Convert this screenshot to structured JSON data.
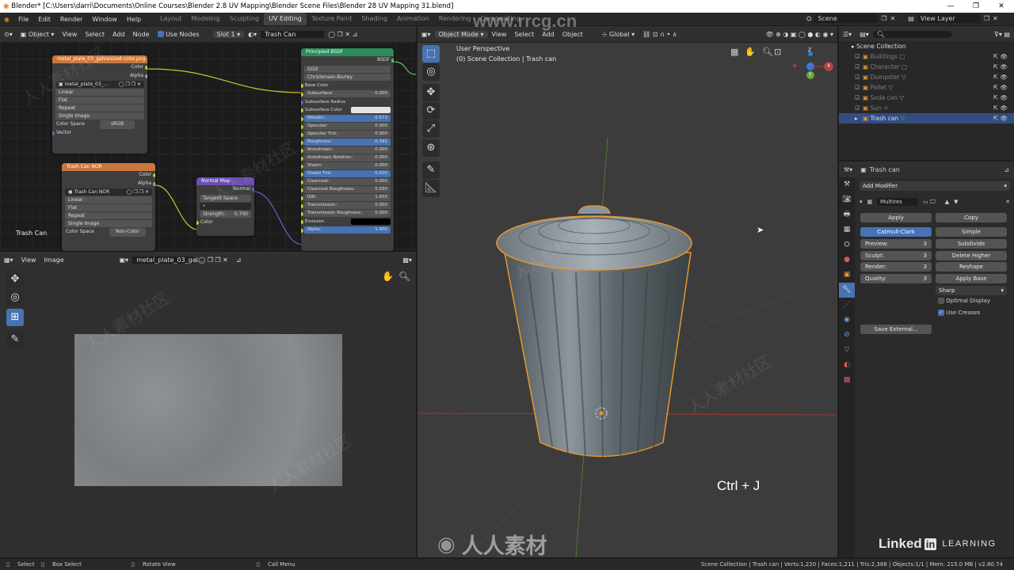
{
  "window": {
    "title": "Blender* [C:\\Users\\darri\\Documents\\Online Courses\\Blender 2.8 UV Mapping\\Blender Scene Files\\Blender 28 UV Mapping 31.blend]"
  },
  "menu": [
    "File",
    "Edit",
    "Render",
    "Window",
    "Help"
  ],
  "workspaces": [
    "Layout",
    "Modeling",
    "Sculpting",
    "UV Editing",
    "Texture Paint",
    "Shading",
    "Animation",
    "Rendering",
    "Compositing"
  ],
  "active_workspace": "UV Editing",
  "scene": {
    "name": "Scene",
    "view_layer": "View Layer"
  },
  "node_editor": {
    "header": {
      "mode": "Object",
      "view": "View",
      "select": "Select",
      "add": "Add",
      "node": "Node",
      "use_nodes": "Use Nodes",
      "slot": "Slot 1",
      "material": "Trash Can"
    },
    "label_material": "Trash Can",
    "node_color": {
      "title": "metal_plate_03_galvanized-color.png",
      "out_color": "Color",
      "out_alpha": "Alpha",
      "image": "metal_plate_03_...",
      "interp": "Linear",
      "proj": "Flat",
      "ext": "Repeat",
      "src": "Single Image",
      "cs_label": "Color Space",
      "cs_val": "sRGB",
      "vector": "Vector"
    },
    "node_nor": {
      "title": "Trash Can NOR",
      "out_color": "Color",
      "out_alpha": "Alpha",
      "image": "Trash Can NOR",
      "interp": "Linear",
      "proj": "Flat",
      "ext": "Repeat",
      "src": "Single Image",
      "cs_label": "Color Space",
      "cs_val": "Non-Color"
    },
    "node_normal": {
      "title": "Normal Map",
      "out": "Normal",
      "space": "Tangent Space",
      "uv": "",
      "strength_label": "Strength:",
      "strength": "0.700",
      "in_color": "Color"
    },
    "node_bsdf": {
      "title": "Principled BSDF",
      "out": "BSDF",
      "dist": "GGX",
      "sss": "Christensen-Burley",
      "rows": [
        {
          "label": "Base Color",
          "value": "",
          "kind": "plain"
        },
        {
          "label": "Subsurface:",
          "value": "0.000",
          "kind": "field"
        },
        {
          "label": "Subsurface Radius",
          "value": "",
          "kind": "plain"
        },
        {
          "label": "Subsurface Color",
          "value": "",
          "kind": "color"
        },
        {
          "label": "Metallic:",
          "value": "0.573",
          "kind": "blue"
        },
        {
          "label": "Specular:",
          "value": "0.000",
          "kind": "field"
        },
        {
          "label": "Specular Tint:",
          "value": "0.000",
          "kind": "field"
        },
        {
          "label": "Roughness",
          "value": "0.341",
          "kind": "blue"
        },
        {
          "label": "Anisotropic:",
          "value": "0.000",
          "kind": "field"
        },
        {
          "label": "Anisotropic Rotation:",
          "value": "0.000",
          "kind": "field"
        },
        {
          "label": "Sheen:",
          "value": "0.000",
          "kind": "field"
        },
        {
          "label": "Sheen Tint:",
          "value": "0.500",
          "kind": "blue"
        },
        {
          "label": "Clearcoat:",
          "value": "0.000",
          "kind": "field"
        },
        {
          "label": "Clearcoat Roughness:",
          "value": "0.030",
          "kind": "field"
        },
        {
          "label": "IOR:",
          "value": "1.450",
          "kind": "field"
        },
        {
          "label": "Transmission:",
          "value": "0.000",
          "kind": "field"
        },
        {
          "label": "Transmission Roughness:",
          "value": "0.000",
          "kind": "field"
        },
        {
          "label": "Emission",
          "value": "",
          "kind": "black"
        },
        {
          "label": "Alpha:",
          "value": "1.000",
          "kind": "blue"
        }
      ]
    }
  },
  "image_editor": {
    "view": "View",
    "image": "Image",
    "image_name": "metal_plate_03_gal..."
  },
  "viewport": {
    "mode": "Object Mode",
    "view": "View",
    "select": "Select",
    "add": "Add",
    "object": "Object",
    "orientation": "Global",
    "perspective": "User Perspective",
    "collection": "(0) Scene Collection | Trash can",
    "shortcut": "Ctrl + J",
    "gizmo": {
      "x": "X",
      "y": "Y",
      "z": "Z"
    }
  },
  "outliner": {
    "root": "Scene Collection",
    "items": [
      "Buildings",
      "Character",
      "Dumpster",
      "Pallet",
      "Soda can",
      "Sun",
      "Trash can"
    ],
    "selected": "Trash can"
  },
  "properties": {
    "object": "Trash can",
    "add_modifier": "Add Modifier",
    "modifier_name": "Multires",
    "apply": "Apply",
    "copy": "Copy",
    "catmull": "Catmull-Clark",
    "simple": "Simple",
    "fields": [
      {
        "label": "Preview:",
        "value": "3"
      },
      {
        "label": "Sculpt:",
        "value": "3"
      },
      {
        "label": "Render:",
        "value": "3"
      },
      {
        "label": "Quality:",
        "value": "3"
      }
    ],
    "subdivide": "Subdivide",
    "delete_higher": "Delete Higher",
    "reshape": "Reshape",
    "apply_base": "Apply Base",
    "sharp": "Sharp",
    "optimal_display": "Optimal Display",
    "use_creases": "Use Creases",
    "save_external": "Save External..."
  },
  "status": {
    "select": "Select",
    "box_select": "Box Select",
    "rotate_view": "Rotate View",
    "call_menu": "Call Menu",
    "info": "Scene Collection | Trash can | Verts:1,220 | Faces:1,211 | Tris:2,368 | Objects:1/1 | Mem: 215.0 MB | v2.80.74"
  },
  "branding": {
    "watermark": "www.rrcg.cn",
    "site": "人人素材",
    "linkedin": "Linked",
    "in": "in",
    "learning": "LEARNING"
  }
}
